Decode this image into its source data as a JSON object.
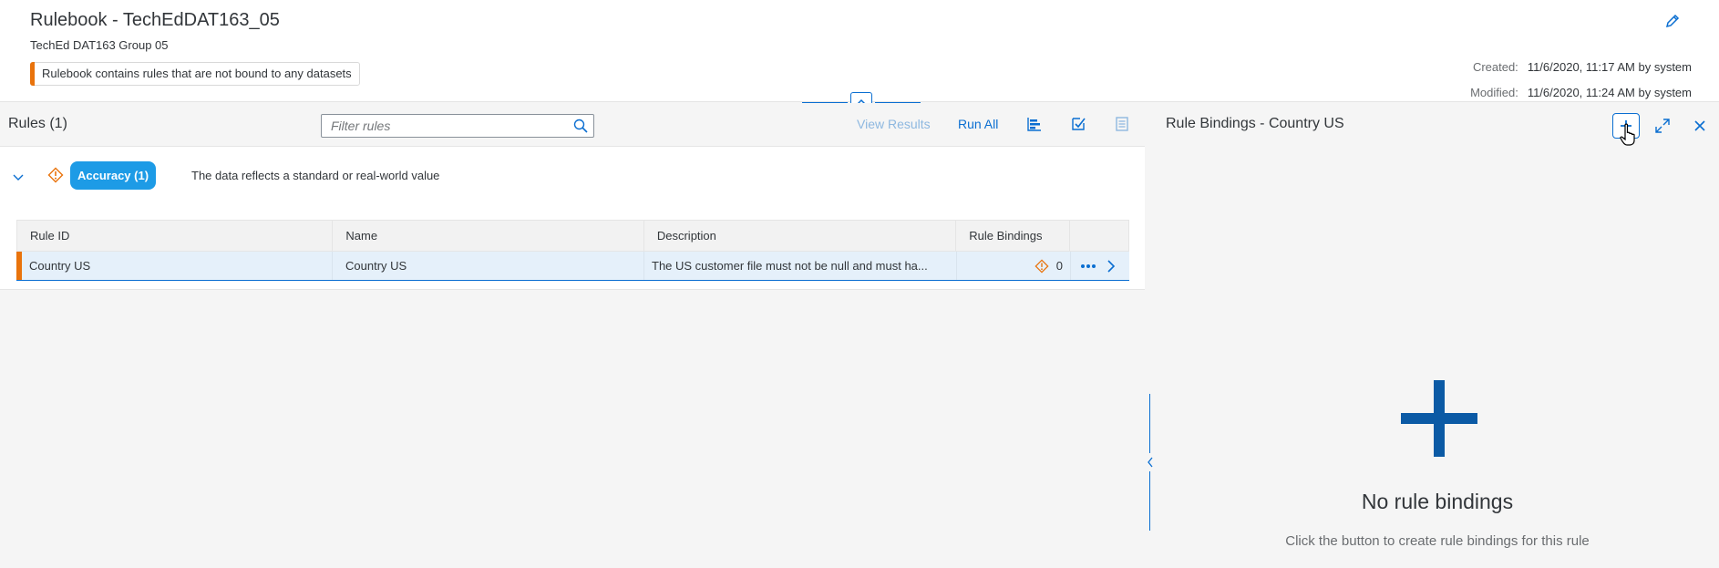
{
  "header": {
    "title": "Rulebook - TechEdDAT163_05",
    "subtitle": "TechEd DAT163 Group 05",
    "warning": "Rulebook contains rules that are not bound to any datasets",
    "created_label": "Created:",
    "created_value": "11/6/2020, 11:17 AM by system",
    "modified_label": "Modified:",
    "modified_value": "11/6/2020, 11:24 AM by system"
  },
  "rules_panel": {
    "title": "Rules (1)",
    "filter_placeholder": "Filter rules",
    "view_results": "View Results",
    "run_all": "Run All",
    "category": {
      "badge": "Accuracy (1)",
      "description": "The data reflects a standard or real-world value"
    },
    "table": {
      "columns": [
        "Rule ID",
        "Name",
        "Description",
        "Rule Bindings"
      ],
      "rows": [
        {
          "rule_id": "Country US",
          "name": "Country US",
          "description": "The US customer file must not be null and must ha...",
          "bindings": "0"
        }
      ]
    }
  },
  "bindings_panel": {
    "title": "Rule Bindings - Country US",
    "empty_title": "No rule bindings",
    "empty_desc": "Click the button to create rule bindings for this rule"
  },
  "colors": {
    "accent": "#0a6ed1",
    "warning": "#e9730c",
    "badge": "#1d9be6",
    "selected_row": "#e5f0fa"
  }
}
